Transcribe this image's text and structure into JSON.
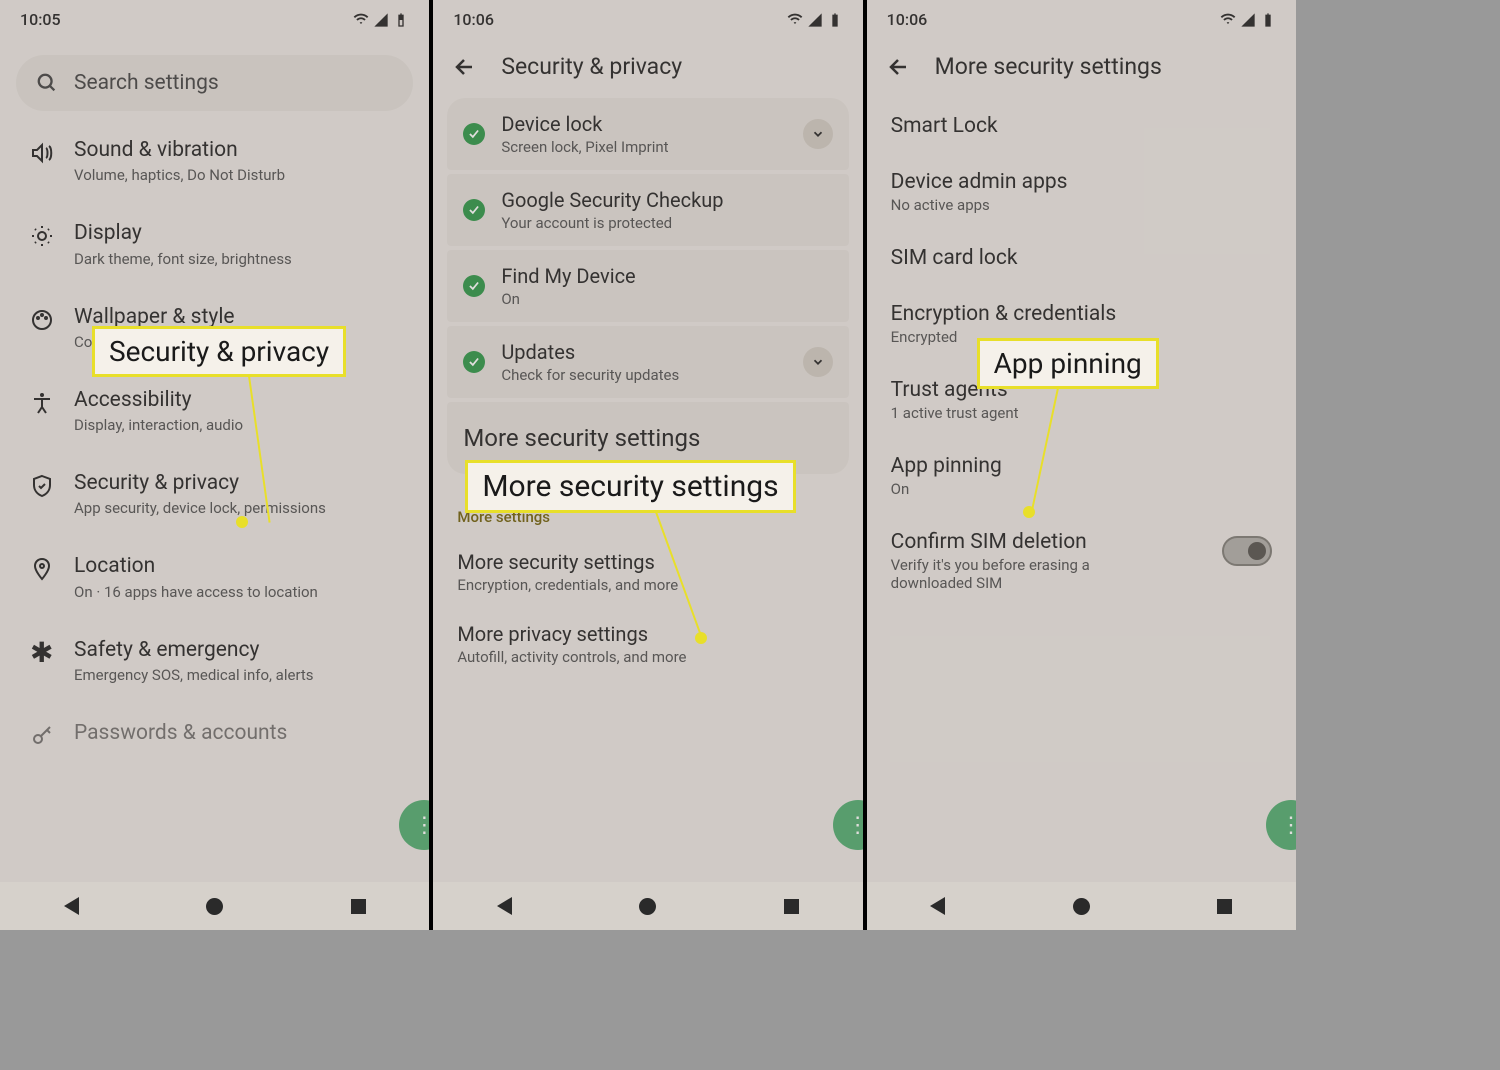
{
  "screen1": {
    "time": "10:05",
    "search_placeholder": "Search settings",
    "items": [
      {
        "title": "Sound & vibration",
        "sub": "Volume, haptics, Do Not Disturb"
      },
      {
        "title": "Display",
        "sub": "Dark theme, font size, brightness"
      },
      {
        "title": "Wallpaper & style",
        "sub": "Colors"
      },
      {
        "title": "Accessibility",
        "sub": "Display, interaction, audio"
      },
      {
        "title": "Security & privacy",
        "sub": "App security, device lock, permissions"
      },
      {
        "title": "Location",
        "sub": "On · 16 apps have access to location"
      },
      {
        "title": "Safety & emergency",
        "sub": "Emergency SOS, medical info, alerts"
      },
      {
        "title": "Passwords & accounts",
        "sub": ""
      }
    ],
    "callout": "Security & privacy"
  },
  "screen2": {
    "time": "10:06",
    "header": "Security & privacy",
    "cards": [
      {
        "title": "Device lock",
        "sub": "Screen lock, Pixel Imprint",
        "chevron": true
      },
      {
        "title": "Google Security Checkup",
        "sub": "Your account is protected",
        "chevron": false
      },
      {
        "title": "Find My Device",
        "sub": "On",
        "chevron": false
      },
      {
        "title": "Updates",
        "sub": "Check for security updates",
        "chevron": true
      },
      {
        "title": "More security settings",
        "sub": "",
        "chevron": false
      }
    ],
    "section_label": "More settings",
    "more": [
      {
        "title": "More security settings",
        "sub": "Encryption, credentials, and more"
      },
      {
        "title": "More privacy settings",
        "sub": "Autofill, activity controls, and more"
      }
    ],
    "callout": "More security settings"
  },
  "screen3": {
    "time": "10:06",
    "header": "More security settings",
    "items": [
      {
        "title": "Smart Lock",
        "sub": ""
      },
      {
        "title": "Device admin apps",
        "sub": "No active apps"
      },
      {
        "title": "SIM card lock",
        "sub": ""
      },
      {
        "title": "Encryption & credentials",
        "sub": "Encrypted"
      },
      {
        "title": "Trust agents",
        "sub": "1 active trust agent"
      },
      {
        "title": "App pinning",
        "sub": "On"
      },
      {
        "title": "Confirm SIM deletion",
        "sub": "Verify it's you before erasing a downloaded SIM",
        "toggle": true
      }
    ],
    "callout": "App pinning"
  }
}
